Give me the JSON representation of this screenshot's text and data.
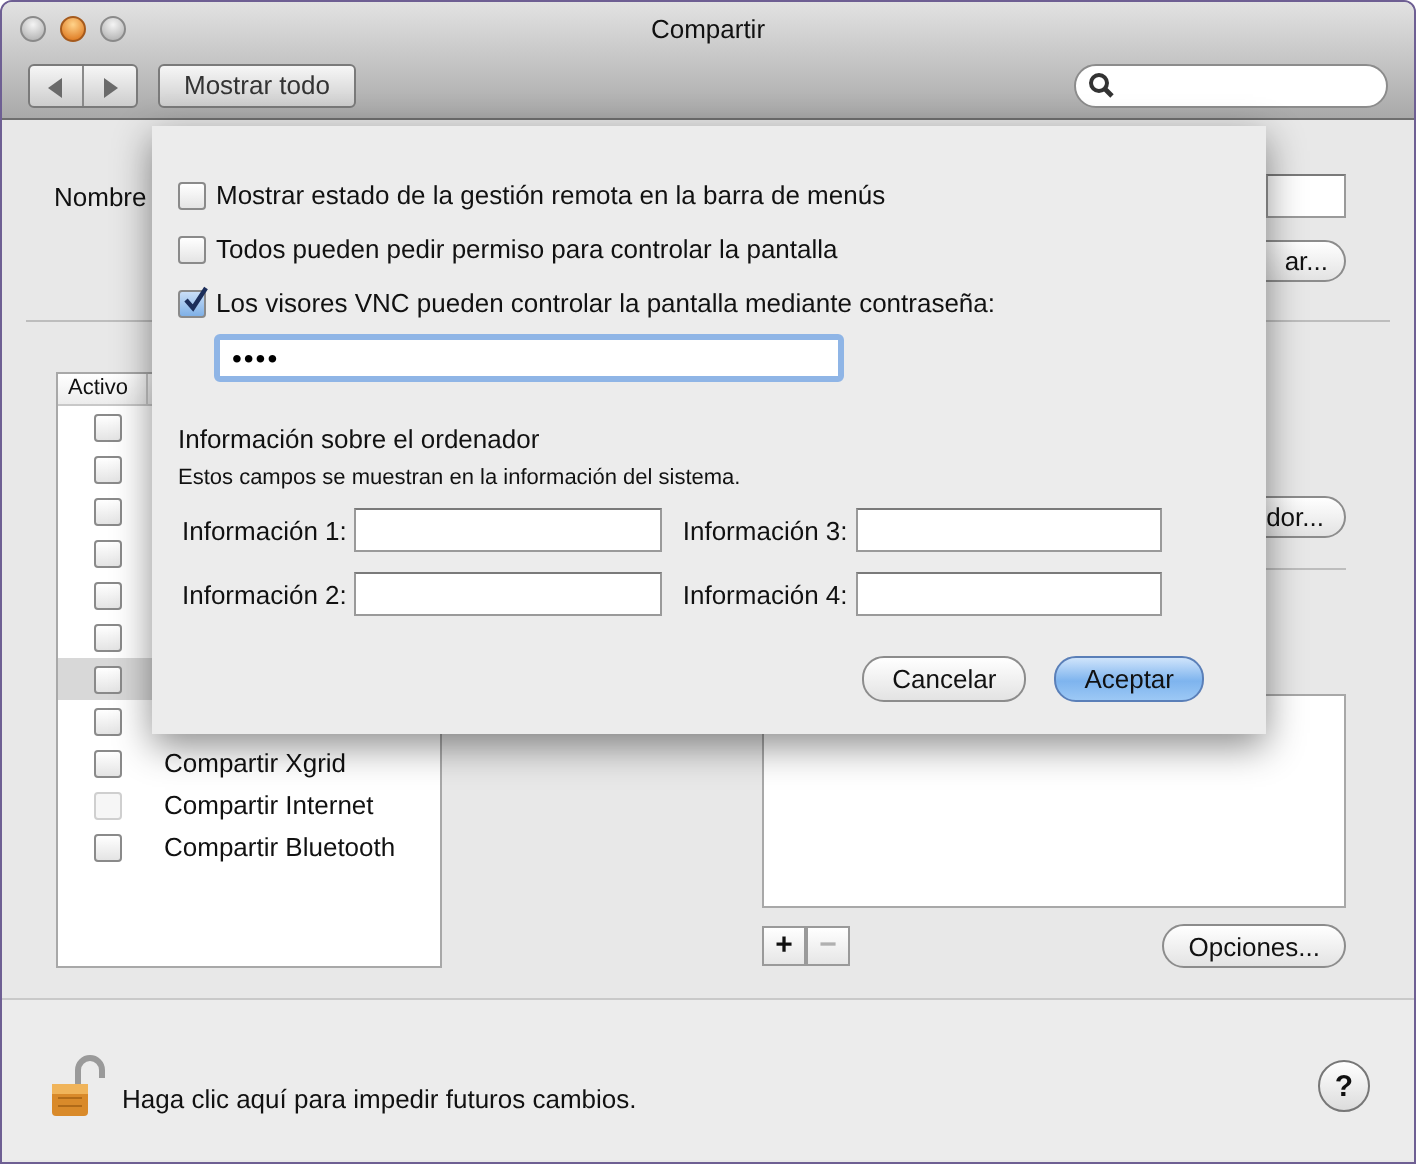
{
  "window": {
    "title": "Compartir"
  },
  "toolbar": {
    "show_all_button": "Mostrar todo"
  },
  "background": {
    "name_label": "Nombre",
    "name_button": "ar...",
    "computer_button": "dor...",
    "services": {
      "header": "Activo",
      "items": [
        {
          "checked": false,
          "selected": false,
          "disabled": false
        },
        {
          "checked": false,
          "selected": false,
          "disabled": false
        },
        {
          "checked": false,
          "selected": false,
          "disabled": false
        },
        {
          "checked": false,
          "selected": false,
          "disabled": false
        },
        {
          "checked": false,
          "selected": false,
          "disabled": false
        },
        {
          "checked": false,
          "selected": false,
          "disabled": false
        },
        {
          "checked": false,
          "selected": true,
          "disabled": false
        },
        {
          "checked": false,
          "selected": false,
          "disabled": false
        },
        {
          "label": "Compartir Xgrid",
          "checked": false,
          "selected": false,
          "disabled": false
        },
        {
          "label": "Compartir Internet",
          "checked": false,
          "selected": false,
          "disabled": true
        },
        {
          "label": "Compartir Bluetooth",
          "checked": false,
          "selected": false,
          "disabled": false
        }
      ]
    },
    "add_button": {
      "label": "+",
      "disabled": false
    },
    "remove_button": {
      "label": "−",
      "disabled": true
    },
    "options_button": "Opciones..."
  },
  "footer": {
    "lock_text": "Haga clic aquí para impedir futuros cambios.",
    "help_button": "?"
  },
  "sheet": {
    "options": [
      {
        "label": "Mostrar estado de la gestión remota en la barra de menús",
        "checked": false
      },
      {
        "label": "Todos pueden pedir permiso para controlar la pantalla",
        "checked": false
      },
      {
        "label": "Los visores VNC pueden controlar la pantalla mediante contraseña:",
        "checked": true
      }
    ],
    "password": {
      "value": "••••"
    },
    "info_heading": "Información sobre el ordenador",
    "info_note": "Estos campos se muestran en la información del sistema.",
    "info_fields": [
      {
        "label": "Información 1:"
      },
      {
        "label": "Información 3:"
      },
      {
        "label": "Información 2:"
      },
      {
        "label": "Información 4:"
      }
    ],
    "buttons": [
      {
        "label": "Cancelar",
        "default": false
      },
      {
        "label": "Aceptar",
        "default": true
      }
    ]
  }
}
